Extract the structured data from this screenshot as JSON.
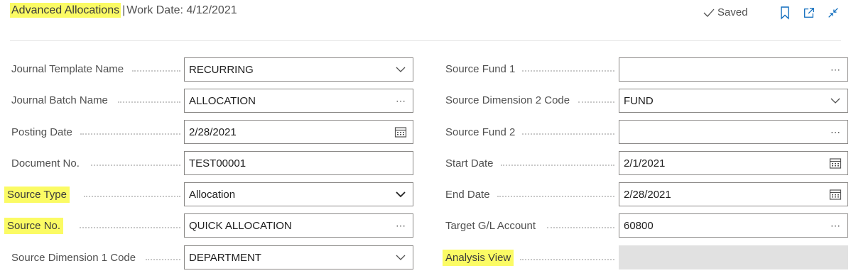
{
  "header": {
    "title": "Advanced Allocations",
    "separator": "|",
    "subtitle": "Work Date: 4/12/2021",
    "saved_label": "Saved",
    "icons": [
      "checkmark-icon",
      "bookmark-icon",
      "open-new-window-icon",
      "collapse-icon"
    ]
  },
  "left_fields": [
    {
      "label": "Journal Template Name",
      "value": "RECURRING",
      "icon": "chevron-down-icon"
    },
    {
      "label": "Journal Batch Name",
      "value": "ALLOCATION",
      "icon": "ellipsis-icon"
    },
    {
      "label": "Posting Date",
      "value": "2/28/2021",
      "icon": "calendar-icon"
    },
    {
      "label": "Document No.",
      "value": "TEST00001",
      "icon": ""
    },
    {
      "label": "Source Type",
      "value": "Allocation",
      "icon": "chevron-down-icon"
    },
    {
      "label": "Source No.",
      "value": "QUICK ALLOCATION",
      "icon": "ellipsis-icon"
    },
    {
      "label": "Source Dimension 1 Code",
      "value": "DEPARTMENT",
      "icon": "chevron-down-icon"
    }
  ],
  "right_fields": [
    {
      "label": "Source Fund 1",
      "value": "",
      "icon": "ellipsis-icon"
    },
    {
      "label": "Source Dimension 2 Code",
      "value": "FUND",
      "icon": "chevron-down-icon"
    },
    {
      "label": "Source Fund 2",
      "value": "",
      "icon": "ellipsis-icon"
    },
    {
      "label": "Start Date",
      "value": "2/1/2021",
      "icon": "calendar-icon"
    },
    {
      "label": "End Date",
      "value": "2/28/2021",
      "icon": "calendar-icon"
    },
    {
      "label": "Target G/L Account",
      "value": "60800",
      "icon": "ellipsis-icon"
    },
    {
      "label": "Analysis View",
      "value": "",
      "icon": ""
    }
  ],
  "highlight_color": "#fbfb64",
  "accent_color": "#0f6cbd"
}
